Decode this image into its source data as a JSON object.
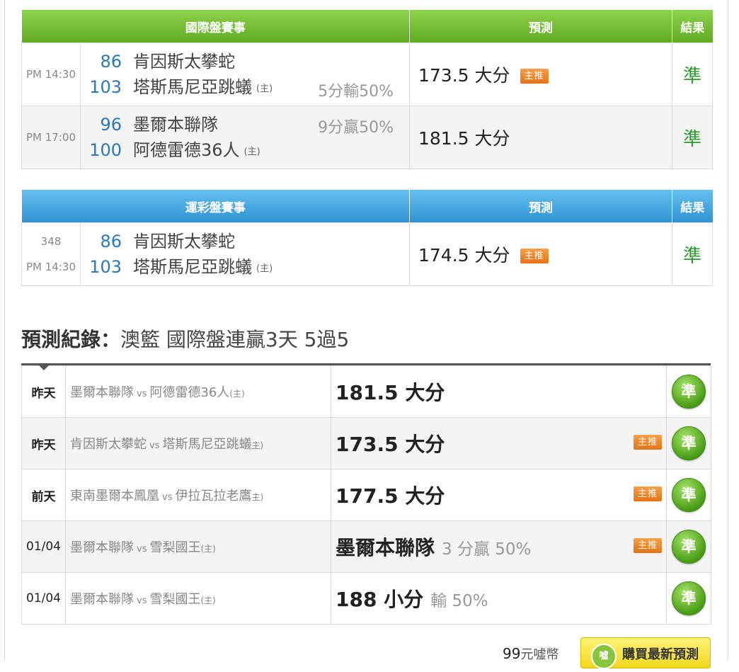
{
  "intl": {
    "headers": [
      "國際盤賽事",
      "預測",
      "結果"
    ],
    "rows": [
      {
        "time": "PM 14:30",
        "away_num": "86",
        "away": "肯因斯太攀蛇",
        "home_num": "103",
        "home": "塔斯馬尼亞跳蟻",
        "home_mark": "(主)",
        "handicap": "5分輸50%",
        "handicap_pos": "bottom",
        "prediction": "173.5 大分",
        "badge": "主推",
        "result": "準"
      },
      {
        "time": "PM 17:00",
        "away_num": "96",
        "away": "墨爾本聯隊",
        "home_num": "100",
        "home": "阿德雷德36人",
        "home_mark": "(主)",
        "handicap": "9分贏50%",
        "handicap_pos": "top",
        "prediction": "181.5 大分",
        "badge": "",
        "result": "準"
      }
    ]
  },
  "lottery": {
    "headers": [
      "運彩盤賽事",
      "預測",
      "結果"
    ],
    "rows": [
      {
        "code": "348",
        "time": "PM 14:30",
        "away_num": "86",
        "away": "肯因斯太攀蛇",
        "home_num": "103",
        "home": "塔斯馬尼亞跳蟻",
        "home_mark": "(主)",
        "prediction": "174.5 大分",
        "badge": "主推",
        "result": "準"
      }
    ]
  },
  "record": {
    "title_label": "預測紀錄：",
    "title_text": "澳籃 國際盤連贏3天 5過5",
    "rows": [
      {
        "day": "昨天",
        "team_a": "墨爾本聯隊",
        "vs": "vs",
        "team_b": "阿德雷德36人",
        "home_mark": "(主)",
        "pick": "181.5 大分",
        "detail": "",
        "badge": "",
        "result": "準"
      },
      {
        "day": "昨天",
        "team_a": "肯因斯太攀蛇",
        "vs": "vs",
        "team_b": "塔斯馬尼亞跳蟻",
        "home_mark": "主)",
        "pick": "173.5 大分",
        "detail": "",
        "badge": "主推",
        "result": "準"
      },
      {
        "day": "前天",
        "team_a": "東南墨爾本鳳凰",
        "vs": "vs",
        "team_b": "伊拉瓦拉老鷹",
        "home_mark": "主)",
        "pick": "177.5 大分",
        "detail": "",
        "badge": "主推",
        "result": "準"
      },
      {
        "day": "01/04",
        "team_a": "墨爾本聯隊",
        "vs": "vs",
        "team_b": "雪梨國王",
        "home_mark": "(主)",
        "pick": "墨爾本聯隊",
        "detail": "3 分贏 50%",
        "badge": "主推",
        "result": "準"
      },
      {
        "day": "01/04",
        "team_a": "墨爾本聯隊",
        "vs": "vs",
        "team_b": "雪梨國王",
        "home_mark": "(主)",
        "pick": "188 小分",
        "detail": "輸 50%",
        "badge": "",
        "result": "準"
      }
    ]
  },
  "footer": {
    "price_num": "99",
    "price_unit": "元噓幣",
    "buy_label": "購買最新預測",
    "buy_icon_text": "噓"
  },
  "colors": {
    "intl_header": "#6fbe2e",
    "lottery_header": "#3fa3e0",
    "result_green": "#2e9a2e",
    "badge_orange": "#ee8a2c",
    "team_number_blue": "#2b78b8"
  }
}
